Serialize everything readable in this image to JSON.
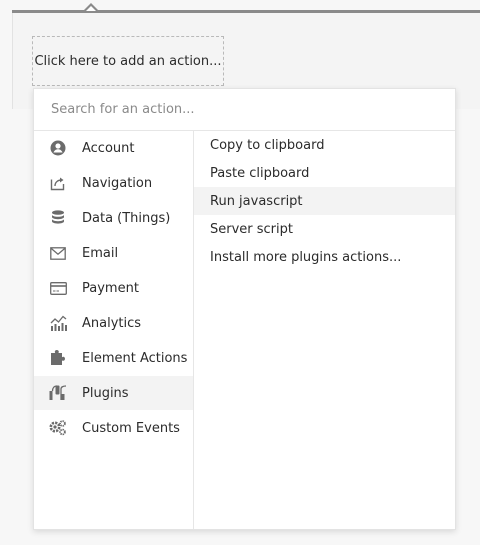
{
  "workflow": {
    "add_action_label": "Click here to add an action..."
  },
  "search": {
    "placeholder": "Search for an action..."
  },
  "categories": [
    {
      "label": "Account",
      "icon": "account-icon"
    },
    {
      "label": "Navigation",
      "icon": "navigation-icon"
    },
    {
      "label": "Data (Things)",
      "icon": "database-icon"
    },
    {
      "label": "Email",
      "icon": "email-icon"
    },
    {
      "label": "Payment",
      "icon": "credit-card-icon"
    },
    {
      "label": "Analytics",
      "icon": "analytics-icon"
    },
    {
      "label": "Element Actions",
      "icon": "puzzle-icon"
    },
    {
      "label": "Plugins",
      "icon": "plugins-icon",
      "selected": true
    },
    {
      "label": "Custom Events",
      "icon": "gears-icon"
    }
  ],
  "actions": [
    {
      "label": "Copy to clipboard"
    },
    {
      "label": "Paste clipboard"
    },
    {
      "label": "Run javascript",
      "hovered": true
    },
    {
      "label": "Server script"
    },
    {
      "label": "Install more plugins actions..."
    }
  ],
  "colors": {
    "icon": "#6b6b6b",
    "highlight": "#f3f3f3",
    "text": "#2b2b2b",
    "placeholder": "#8a8a8a"
  }
}
